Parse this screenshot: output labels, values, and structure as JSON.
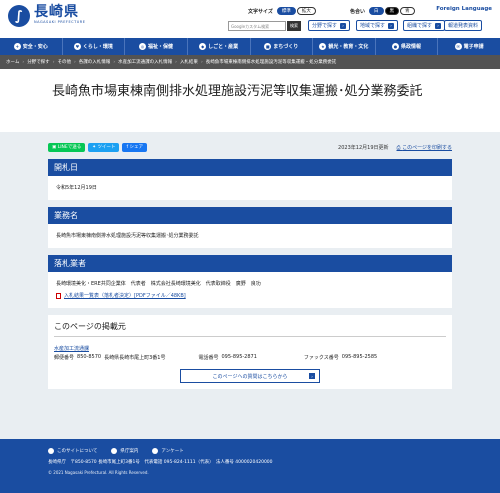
{
  "header": {
    "logo_mark": "∫",
    "logo_title": "長崎県",
    "logo_sub": "NAGASAKI PREFECTURE",
    "text_size_label": "文字サイズ",
    "size_standard": "標準",
    "size_large": "拡大",
    "color_label": "色合い",
    "color_white": "白",
    "color_black": "黒",
    "color_blue": "青",
    "foreign_language": "Foreign Language",
    "search_placeholder": "Googleカスタム検索",
    "search_button": "検索",
    "quick_links": [
      "分野で探す",
      "地域で探す",
      "組織で探す",
      "報道発表資料"
    ]
  },
  "gnav": [
    {
      "icon": "+",
      "label": "安全・安心"
    },
    {
      "icon": "♥",
      "label": "くらし・環境"
    },
    {
      "icon": "◎",
      "label": "福祉・保健"
    },
    {
      "icon": "◆",
      "label": "しごと・産業"
    },
    {
      "icon": "■",
      "label": "まちづくり"
    },
    {
      "icon": "★",
      "label": "観光・教育・文化"
    },
    {
      "icon": "●",
      "label": "県政情報"
    },
    {
      "icon": "✉",
      "label": "電子申請"
    }
  ],
  "breadcrumbs": [
    "ホーム",
    "分野で探す",
    "その他",
    "各課の入札情報",
    "水産加工流通課の入札情報",
    "入札結果",
    "長崎魚市場東棟南側排水処理施設汚泥等収集運搬・処分業務委託"
  ],
  "page_title": "長崎魚市場東棟南側排水処理施設汚泥等収集運搬･処分業務委託",
  "share": {
    "line": "LINEで送る",
    "tweet": "ツイート",
    "facebook": "シェア"
  },
  "updated": "2023年12月19日更新",
  "print": "このページを印刷する",
  "sections": {
    "open_date": {
      "title": "開札日",
      "body": "令和5年12月19日"
    },
    "task_name": {
      "title": "業務名",
      "body": "長崎魚市場東棟南側排水処理施設汚泥等収集運搬･処分業務委託"
    },
    "winner": {
      "title": "落札業者",
      "body": "長崎環境美化・ERE共同企業体　代表者　株式会社長崎環境美化　代表取締役　廣野　良功",
      "pdf": "入札結果一覧表（落札者決定）[PDFファイル／48KB]"
    }
  },
  "published": {
    "title": "このページの掲載元",
    "dept": "水産加工流通課",
    "postal_label": "郵便番号",
    "postal": "850-8570",
    "address": "長崎県長崎市尾上町3番1号",
    "phone_label": "電話番号",
    "phone": "095-895-2871",
    "fax_label": "ファックス番号",
    "fax": "095-895-2585",
    "inquiry": "このページへの質問はこちらから"
  },
  "footer": {
    "links": [
      "このサイトについて",
      "県庁案内",
      "アンケート"
    ],
    "address": "長崎県庁　〒850-8570 長崎市尾上町3番1号　代表電話 095-824-1111（代表）　法人番号 4000020420000",
    "copyright": "© 2021 Nagasaki Prefectural. All Rights Reserved."
  },
  "colors": {
    "primary": "#1a4da1",
    "line": "#06c755",
    "twitter": "#1da1f2",
    "facebook": "#1877f2"
  }
}
